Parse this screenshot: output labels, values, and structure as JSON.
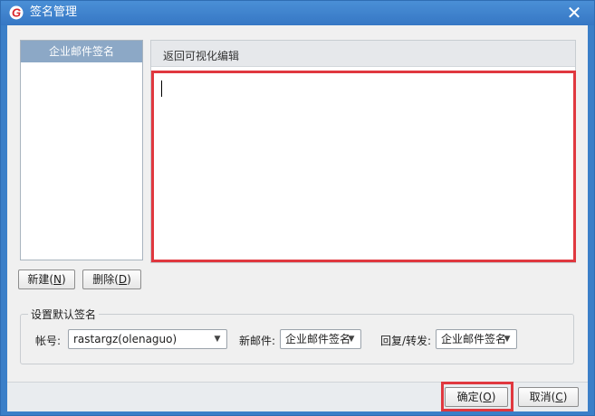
{
  "window": {
    "title": "签名管理",
    "close_glyph": "✕",
    "logo_letter": "G",
    "accent_color": "#3b7fc8",
    "highlight_color": "#e0383f"
  },
  "signature_list": {
    "items": [
      {
        "label": "企业邮件签名",
        "selected": true
      }
    ]
  },
  "editor": {
    "back_link": "返回可视化编辑",
    "content": ""
  },
  "buttons": {
    "new_label": "新建(",
    "new_key": "N",
    "new_suffix": ")",
    "delete_label": "删除(",
    "delete_key": "D",
    "delete_suffix": ")",
    "ok_label": "确定(",
    "ok_key": "O",
    "ok_suffix": ")",
    "cancel_label": "取消(",
    "cancel_key": "C",
    "cancel_suffix": ")"
  },
  "default_signature": {
    "group_title": "设置默认签名",
    "account_label": "帐号:",
    "account_value": "rastargz(olenaguo)",
    "new_mail_label": "新邮件:",
    "new_mail_value": "企业邮件签名",
    "reply_label": "回复/转发:",
    "reply_value": "企业邮件签名"
  },
  "icons": {
    "dropdown": "chevron-down-icon",
    "close": "close-icon",
    "logo": "app-logo-icon"
  }
}
